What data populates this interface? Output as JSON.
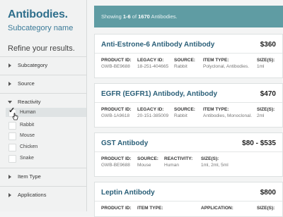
{
  "sidebar": {
    "title": "Antibodies.",
    "subtitle": "Subcategory name",
    "refine": "Refine your results.",
    "facets": [
      {
        "label": "Subcategory"
      },
      {
        "label": "Source"
      },
      {
        "label": "Reactivity"
      },
      {
        "label": "Item Type"
      },
      {
        "label": "Applications"
      }
    ],
    "reactivity_options": [
      {
        "label": "Human",
        "checked": true
      },
      {
        "label": "Rabbit",
        "checked": false
      },
      {
        "label": "Mouse",
        "checked": false
      },
      {
        "label": "Chicken",
        "checked": false
      },
      {
        "label": "Snake",
        "checked": false
      }
    ],
    "check_glyph": "✓"
  },
  "banner": {
    "prefix": "Showing ",
    "range": "1-6",
    "middle": " of ",
    "total": "1670",
    "suffix": " Antibodies.",
    "color": "#5f9ca3"
  },
  "products": [
    {
      "name": "Anti-Estrone-6 Antibody Antibody",
      "price": "$360",
      "attrs": [
        {
          "key": "PRODUCT ID:",
          "value": "GWB-BE9688"
        },
        {
          "key": "LEGACY ID:",
          "value": "18-251-404665"
        },
        {
          "key": "SOURCE:",
          "value": "Rabbit"
        },
        {
          "key": "ITEM TYPE:",
          "value": "Polyclonal, Antibodies."
        },
        {
          "key": "SIZE(S):",
          "value": "1ml"
        }
      ]
    },
    {
      "name": "EGFR (EGFR1) Antibody, Antibody",
      "price": "$470",
      "attrs": [
        {
          "key": "PRODUCT ID:",
          "value": "GWB-1A9618"
        },
        {
          "key": "LEGACY ID:",
          "value": "20-151-385009"
        },
        {
          "key": "SOURCE:",
          "value": "Rabbit"
        },
        {
          "key": "ITEM TYPE:",
          "value": "Antibodies, Monoclonal."
        },
        {
          "key": "SIZE(S):",
          "value": "2ml"
        }
      ]
    },
    {
      "name": "GST Antibody",
      "price": "$80 - $535",
      "attrs": [
        {
          "key": "PRODUCT ID:",
          "value": "GWB-BE9688"
        },
        {
          "key": "SOURCE:",
          "value": "Mouse"
        },
        {
          "key": "REACTIVITY:",
          "value": "Human"
        },
        {
          "key": "SIZE(S):",
          "value": "1ml, 2ml, 5ml"
        }
      ]
    },
    {
      "name": "Leptin Antibody",
      "price": "$800",
      "attrs": [
        {
          "key": "PRODUCT ID:",
          "value": ""
        },
        {
          "key": "ITEM TYPE:",
          "value": ""
        },
        {
          "key": "APPLICATION:",
          "value": ""
        },
        {
          "key": "SIZE(S):",
          "value": ""
        }
      ]
    }
  ]
}
